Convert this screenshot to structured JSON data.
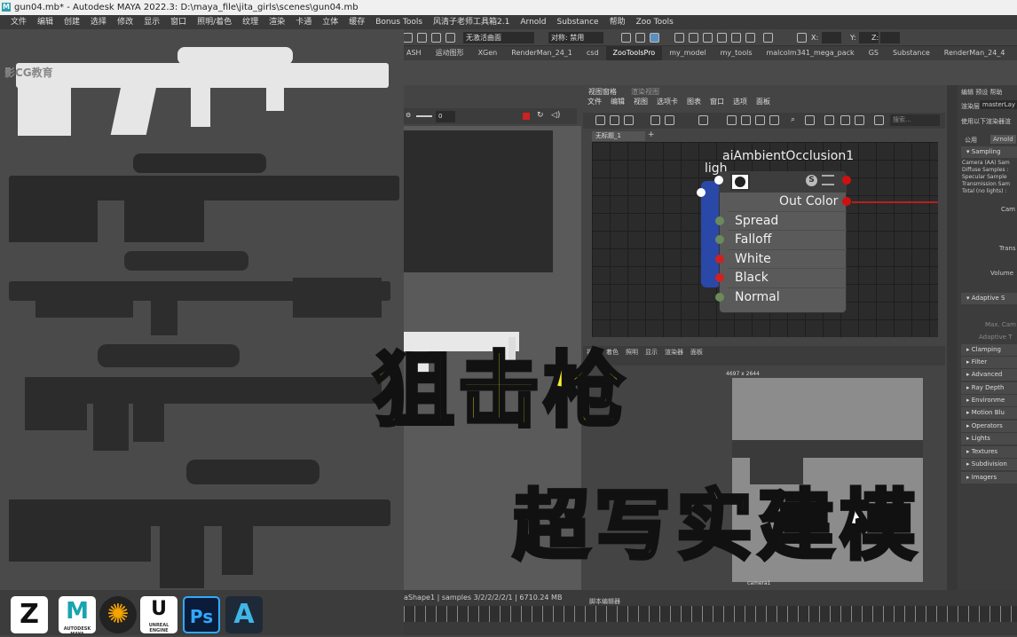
{
  "window": {
    "title": "gun04.mb* - Autodesk MAYA 2022.3: D:\\maya_file\\jita_girls\\scenes\\gun04.mb"
  },
  "menubar": [
    "文件",
    "编辑",
    "创建",
    "选择",
    "修改",
    "显示",
    "窗口",
    "照明/着色",
    "纹理",
    "渲染",
    "卡通",
    "立体",
    "缓存",
    "Bonus Tools",
    "风清子老师工具箱2.1",
    "Arnold",
    "Substance",
    "帮助",
    "Zoo Tools"
  ],
  "toolbar": {
    "render_field": "无激活曲面",
    "symmetry": "对称: 禁用",
    "x_label": "X:",
    "y_label": "Y:",
    "z_label": "Z:"
  },
  "shelf_tabs": [
    "ASH",
    "运动图形",
    "XGen",
    "RenderMan_24_1",
    "csd",
    "ZooToolsPro",
    "my_model",
    "my_tools",
    "malcolm341_mega_pack",
    "GS",
    "Substance",
    "RenderMan_24_4"
  ],
  "shelf_active": "ZooToolsPro",
  "viewport": {
    "frame_value": "0"
  },
  "hypershade": {
    "tabs": [
      "视图窗格",
      "渲染视图"
    ],
    "menu": [
      "文件",
      "编辑",
      "视图",
      "选项卡",
      "图表",
      "窗口",
      "选项",
      "面板"
    ],
    "search_placeholder": "搜索...",
    "doc_tab": "无标题_1"
  },
  "node": {
    "title": "aiAmbientOcclusion1",
    "light_label": "ligh",
    "output": "Out Color",
    "ports": [
      "Spread",
      "Falloff",
      "White",
      "Black",
      "Normal"
    ],
    "port_colors": [
      "#6a8a5a",
      "#6a8a5a",
      "#cc2222",
      "#cc2222",
      "#6a8a5a"
    ]
  },
  "render_view": {
    "menu": [
      "视图",
      "着色",
      "照明",
      "显示",
      "渲染器",
      "面板"
    ],
    "size": "4697 x 2644",
    "camera": "camera1"
  },
  "attributes": {
    "menu": [
      "编辑",
      "预设",
      "帮助"
    ],
    "layer_label": "渲染层",
    "layer_value": "masterLay",
    "hint": "使用以下渲染器渲",
    "tabs": [
      "公用",
      "Arnold"
    ],
    "sampling_header": "Sampling",
    "sampling_items": [
      "Camera (AA) Sam",
      "Diffuse Samples :",
      "Specular Sample",
      "Transmission Sam",
      "Total (no lights) :"
    ],
    "right_labels": [
      "Cam",
      "Trans",
      "Volume"
    ],
    "adaptive_header": "Adaptive S",
    "adaptive_items": [
      "Max. Cam",
      "Adaptive T"
    ],
    "sections": [
      "Clamping",
      "Filter",
      "Advanced",
      "Ray Depth",
      "Environme",
      "Motion Blu",
      "Operators",
      "Lights",
      "Textures",
      "Subdivision",
      "Imagers"
    ]
  },
  "status": {
    "shape": "aShape1",
    "samples": "samples 3/2/2/2/2/1",
    "memory": "6710.24 MB",
    "script_editor": "脚本编辑器"
  },
  "app_icons": [
    {
      "name": "zbrush",
      "label": "Z"
    },
    {
      "name": "maya",
      "label": "M",
      "sub": "AUTODESK MAYA"
    },
    {
      "name": "substance",
      "label": "✺"
    },
    {
      "name": "unreal",
      "label": "U",
      "sub": "UNREAL ENGINE"
    },
    {
      "name": "photoshop",
      "label": "Ps"
    },
    {
      "name": "arnold",
      "label": "A"
    }
  ],
  "overlay": {
    "line1": "狙击枪",
    "line2": "超写实建模"
  },
  "watermark": "影CG教育"
}
